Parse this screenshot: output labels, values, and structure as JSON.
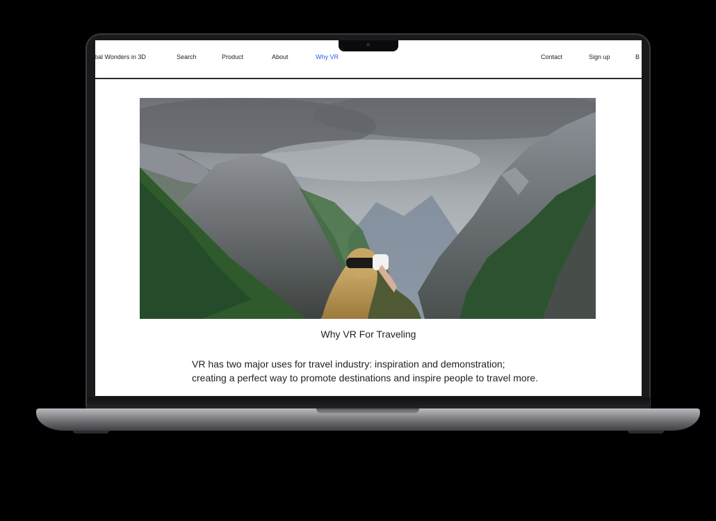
{
  "nav": {
    "brand": "obal Wonders in 3D",
    "links": [
      "Search",
      "Product",
      "About",
      "Why VR",
      "Contact",
      "Sign up",
      "B"
    ],
    "active": "Why VR"
  },
  "hero": {
    "image": "vr-traveler-mountains"
  },
  "section": {
    "title": "Why VR For Traveling",
    "line1": "VR has two major uses for travel industry: inspiration and demonstration;",
    "line2": "creating a perfect way to promote destinations and inspire people to travel more."
  },
  "colors": {
    "active_link": "#2f5df0",
    "background": "#000000",
    "text": "#1e1e1e"
  }
}
